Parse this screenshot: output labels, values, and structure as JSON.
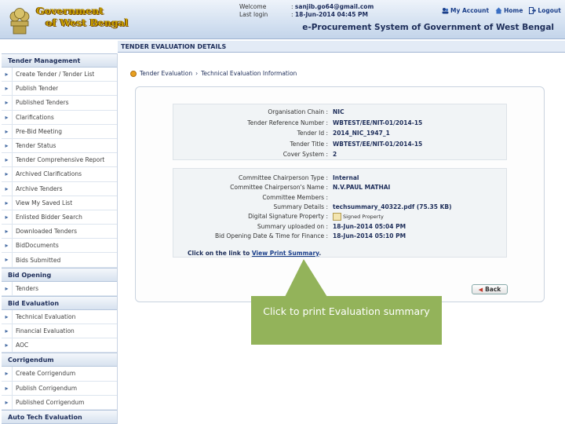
{
  "header": {
    "logo_line1": "Government",
    "logo_line2": "of West Bengal",
    "welcome_label": "Welcome",
    "welcome_value": "sanjib.go64@gmail.com",
    "last_login_label": "Last login",
    "last_login_value": "18-Jun-2014 04:45 PM",
    "my_account": "My Account",
    "home": "Home",
    "logout": "Logout",
    "system_name": "e-Procurement System of Government of West Bengal"
  },
  "page_title": "TENDER EVALUATION DETAILS",
  "breadcrumb": [
    "Tender Evaluation",
    "Technical Evaluation Information"
  ],
  "sidebar": {
    "sections": [
      {
        "title": "Tender Management",
        "items": [
          "Create Tender / Tender List",
          "Publish Tender",
          "Published Tenders",
          "Clarifications",
          "Pre-Bid Meeting",
          "Tender Status",
          "Tender Comprehensive Report",
          "Archived Clarifications",
          "Archive Tenders",
          "View My Saved List",
          "Enlisted Bidder Search",
          "Downloaded Tenders",
          "BidDocuments",
          "Bids Submitted"
        ]
      },
      {
        "title": "Bid Opening",
        "items": [
          "Tenders"
        ]
      },
      {
        "title": "Bid Evaluation",
        "items": [
          "Technical Evaluation",
          "Financial Evaluation",
          "AOC"
        ]
      },
      {
        "title": "Corrigendum",
        "items": [
          "Create Corrigendum",
          "Publish Corrigendum",
          "Published Corrigendum"
        ]
      },
      {
        "title": "Auto Tech Evaluation",
        "items": []
      }
    ]
  },
  "details1": [
    {
      "k": "Organisation Chain :",
      "v": "NIC"
    },
    {
      "k": "Tender Reference Number :",
      "v": "WBTEST/EE/NIT-01/2014-15"
    },
    {
      "k": "Tender Id :",
      "v": "2014_NIC_1947_1"
    },
    {
      "k": "Tender Title :",
      "v": "WBTEST/EE/NIT-01/2014-15"
    },
    {
      "k": "Cover System :",
      "v": "2"
    }
  ],
  "details2": [
    {
      "k": "Committee Chairperson Type :",
      "v": "Internal"
    },
    {
      "k": "Committee Chairperson's Name :",
      "v": "N.V.PAUL MATHAI"
    },
    {
      "k": "Committee Members :",
      "v": ""
    },
    {
      "k": "Summary Details :",
      "v": "techsummary_40322.pdf (75.35 KB)"
    },
    {
      "k": "Digital Signature Property :",
      "v": "Signed Property"
    },
    {
      "k": "Summary uploaded on :",
      "v": "18-Jun-2014 05:04 PM"
    },
    {
      "k": "Bid Opening Date & Time for Finance :",
      "v": "18-Jun-2014 05:10 PM"
    }
  ],
  "print_link_prefix": "Click on the link to",
  "print_link_text": "View Print Summary",
  "back_button": "Back",
  "callout_text": "Click to print Evaluation summary"
}
